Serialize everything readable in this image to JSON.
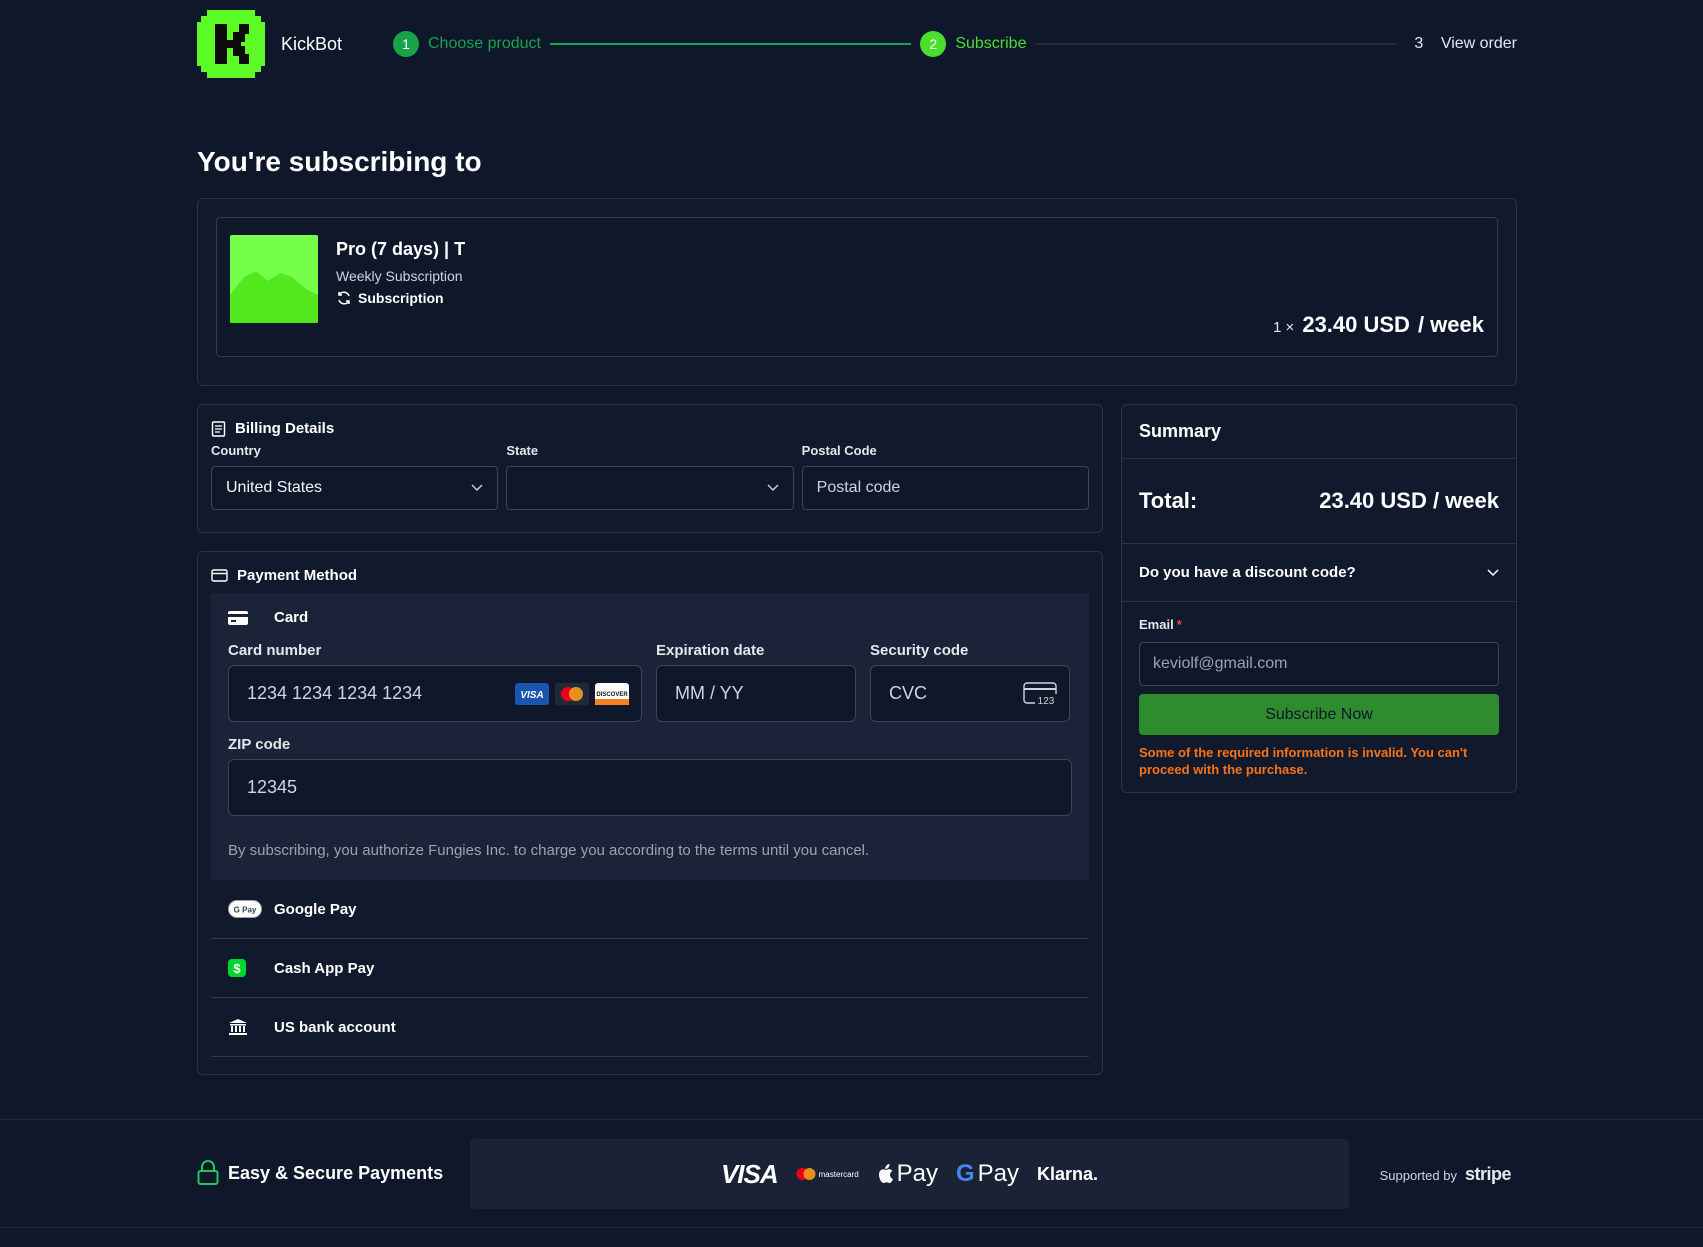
{
  "brand": {
    "name": "KickBot"
  },
  "stepper": {
    "steps": [
      {
        "num": "1",
        "label": "Choose product"
      },
      {
        "num": "2",
        "label": "Subscribe"
      },
      {
        "num": "3",
        "label": "View order"
      }
    ]
  },
  "page": {
    "title": "You're subscribing to"
  },
  "product": {
    "name": "Pro (7 days) | T",
    "subtitle": "Weekly Subscription",
    "type": "Subscription",
    "qty": "1 ×",
    "amount": "23.40 USD",
    "period": "/ week"
  },
  "billing": {
    "title": "Billing Details",
    "country_label": "Country",
    "country_value": "United States",
    "state_label": "State",
    "state_value": "",
    "postal_label": "Postal Code",
    "postal_placeholder": "Postal code"
  },
  "payment": {
    "title": "Payment Method",
    "card_label": "Card",
    "card_number_label": "Card number",
    "card_number_placeholder": "1234 1234 1234 1234",
    "expiry_label": "Expiration date",
    "expiry_placeholder": "MM / YY",
    "cvc_label": "Security code",
    "cvc_placeholder": "CVC",
    "cvc_icon_text": "123",
    "zip_label": "ZIP code",
    "zip_placeholder": "12345",
    "terms": "By subscribing, you authorize Fungies Inc. to charge you according to the terms until you cancel.",
    "card_brands": [
      "VISA",
      "DISCOVER"
    ],
    "methods": [
      {
        "label": "Google Pay",
        "icon": "google-pay-icon",
        "icon_text": "G Pay"
      },
      {
        "label": "Cash App Pay",
        "icon": "cash-app-icon",
        "icon_text": "$"
      },
      {
        "label": "US bank account",
        "icon": "bank-icon"
      }
    ]
  },
  "summary": {
    "title": "Summary",
    "total_label": "Total:",
    "total_value": "23.40 USD / week",
    "discount_label": "Do you have a discount code?",
    "email_label": "Email",
    "email_required": "*",
    "email_value": "keviolf@gmail.com",
    "button_label": "Subscribe Now",
    "error": "Some of the required information is invalid. You can't proceed with the purchase."
  },
  "footer": {
    "secure_label": "Easy & Secure Payments",
    "logos": {
      "visa": "VISA",
      "mastercard": "mastercard",
      "apple_pay": "Pay",
      "google_pay_g": "G",
      "google_pay": "Pay",
      "klarna": "Klarna."
    },
    "supported_by": "Supported by",
    "stripe": "stripe"
  },
  "colors": {
    "background": "#0f172a",
    "accent_green": "#4ade2f",
    "done_green": "#16a34a",
    "button_green": "#2e8b2e",
    "error_orange": "#f97316"
  }
}
